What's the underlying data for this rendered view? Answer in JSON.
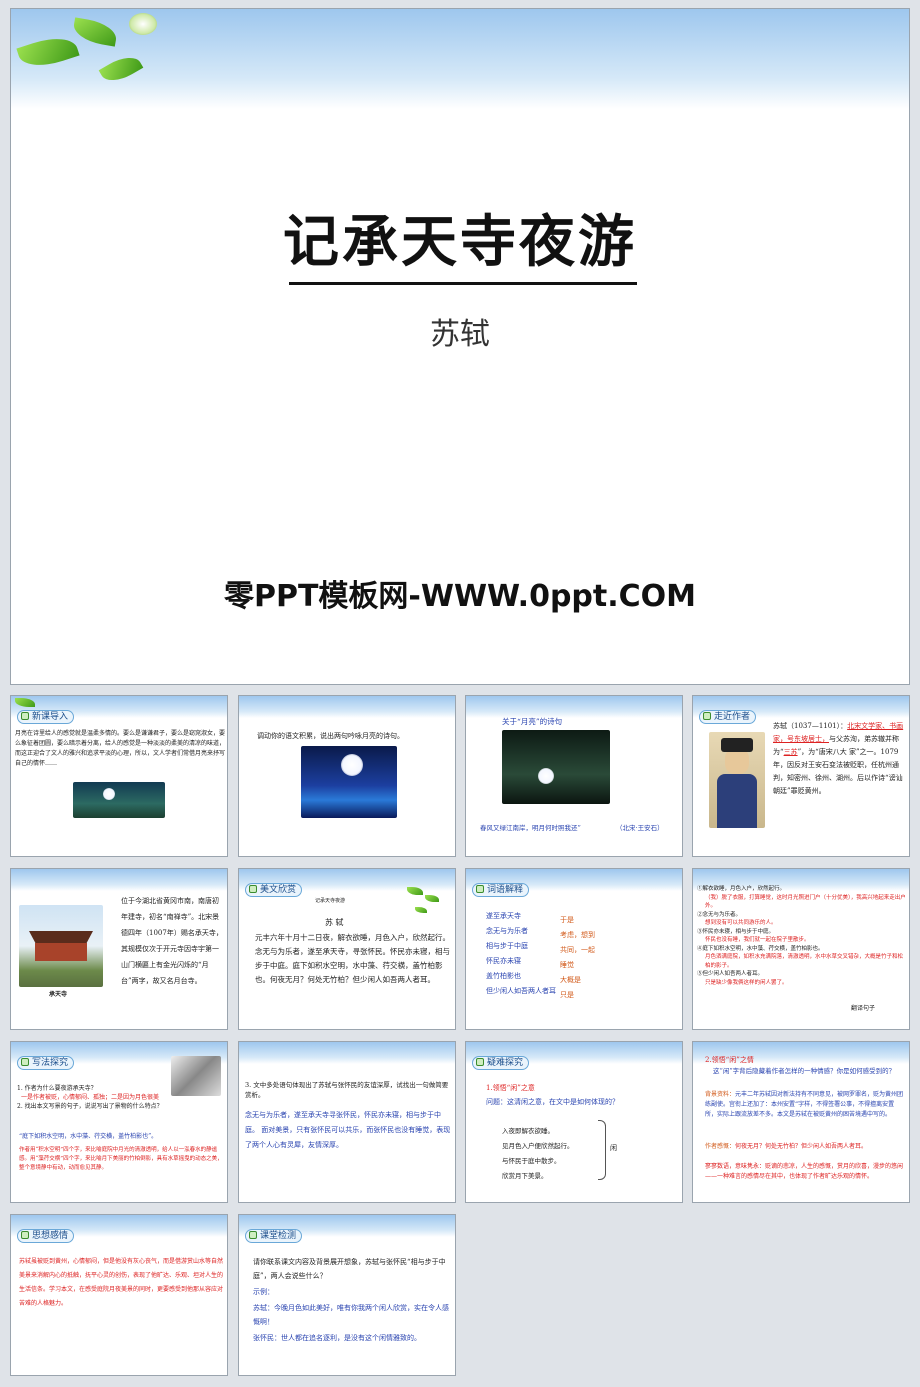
{
  "cover": {
    "title": "记承天寺夜游",
    "author": "苏轼",
    "site": "零PPT模板网-WWW.0ppt.COM"
  },
  "s1": {
    "tag": "新课导入",
    "text": "月亮在诗里给人的感觉就是温柔多情的。要么是谦谦君子，要么是窈窕淑女，要么象征着团圆，要么暗示着分离，给人的感觉是一种淡淡的柔美的清凉的味道，而这正迎合了文人的雅兴和追求平淡的心理，所以，文人学者们常借月亮来抒写自己的情怀……"
  },
  "s2": {
    "text": "调动你的语文积累，说出两句吟咏月亮的诗句。"
  },
  "s3": {
    "head": "关于“月亮”的诗句",
    "poem": "春风又绿江南岸，明月何时照我还”",
    "cite": "（北宋·王安石）"
  },
  "s4": {
    "tag": "走近作者",
    "t1": "苏轼（1037—1101）：",
    "t1r": "北宋文学家、书画家，号东坡居士，",
    "t2": "与父苏洵，弟苏辙并称为“",
    "t2r": "三苏",
    "t3": "”，为“唐宋八大 家”之一。1079年，因反对王安石变法被贬职，任杭州通判，知密州、徐州、湖州。后以作诗“谤讪朝廷”罪贬黄州。"
  },
  "s5": {
    "text": "位于今湖北省黄冈市南，南唐初年建寺，初名“南禅寺”。北宋景德四年（1007年）赐名承天寺，其规模仅次于开元寺因寺宇第一山门横匾上有金光闪烁的“月台”两字，故又名月台寺。",
    "caption": "承天寺"
  },
  "s6": {
    "tag": "美文欣赏",
    "small": "记承天寺夜游",
    "author": "苏 轼",
    "text": "元丰六年十月十二日夜，解衣欲睡，月色入户，欣然起行。念无与为乐者，遂至承天寺，寻张怀民。怀民亦未寝，相与步于中庭。庭下如积水空明，水中藻、荇交横，盖竹柏影也。何夜无月？何处无竹柏？但少闲人如吾两人者耳。"
  },
  "s7": {
    "tag": "词语解释",
    "words": [
      "遂至承天寺",
      "念无与为乐者",
      "相与步于中庭",
      "怀民亦未寝",
      "盖竹柏影也",
      "但少闲人如吾两人者耳"
    ],
    "meanings": [
      "于是",
      "考虑，想到",
      "共同，一起",
      "睡觉",
      "大概是",
      "只是"
    ]
  },
  "s8": {
    "l1": "①解衣欲睡，月色入户，欣然起行。",
    "l1a": "（我）脱了衣服，打算睡觉，这时月光照进门户（十分优美），我高兴地起来走出户外。",
    "l2": "②念无与为乐者。",
    "l2a": "想到没有可以共同游乐的人。",
    "l3": "③怀民亦未寝，相与步于中庭。",
    "l3a": "怀民也没有睡，我们就一起在院子里散步。",
    "l4": "④庭下如积水空明，水中藻、荇交横，盖竹柏影也。",
    "l4a": "月色洒满庭院，如积水充满院落，清澈透明，水中水草交叉错杂，大概是竹子和松柏的影子。",
    "l5": "⑤但少闲人如吾两人者耳。",
    "l5a": "只是缺少像我俩这样的闲人罢了。",
    "note": "翻译句子"
  },
  "s9": {
    "tag": "写法探究",
    "q1": "1. 作者为什么要夜游承天寺？",
    "a1": "一是作者被贬，心情郁闷、孤独；二是因为月色很美",
    "q2": "2. 找出本文写景的句子，说说写出了景物的什么特点？",
    "quote": "“庭下如积水空明，水中藻、荇交横，盖竹柏影也”。",
    "ans": "作者用“积水空明”四个字，来比喻庭院中月光的清澈透明，给人以一泓春水的静谧感。用“藻荇交横”四个字，来比喻月下美丽的竹柏倒影，具有水草摇曳的动态之美，整个意境静中有动，动而愈见其静。"
  },
  "s10": {
    "q": "3. 文中多处语句体现出了苏轼与张怀民的友谊深厚，试找出一句做简要赏析。",
    "a": "念无与为乐者，遂至承天寺寻张怀民，怀民亦未寝，相与步于中庭。 面对美景，只有张怀民可以共乐，而张怀民也没有睡觉，表现了两个人心有灵犀，友情深厚。"
  },
  "s11": {
    "tag": "疑难探究",
    "h": "1.领悟“闲”之意",
    "q": "问题：这清闲之意，在文中是如何体现的？",
    "items": [
      "入夜即解衣欲睡。",
      "见月色入户便欣然起行。",
      "与怀民于庭中散步。",
      "欣赏月下美景。"
    ],
    "brace": "闲"
  },
  "s12": {
    "h": "2.领悟“闲”之情",
    "q": "这“闲”字背后隐藏着作者怎样的一种情感？你是如何感受到的？",
    "bg_label": "背景资料：",
    "bg": "元丰二年苏轼因对新法持有不同意见，被网罗罪名，贬为黄州团练副使。宫衔上还加了：本州安置“字样，不得签署公事，不得擅离安置所，实际上跟流放差不多。本文是苏轼在被贬黄州的困苦境遇中写的。",
    "f_label": "作者感慨：",
    "f": "何夜无月？何处无竹柏？但少闲人如吾两人者耳。",
    "e": "寥寥数语，意味隽永：贬谪的悲凉，人生的感慨，赏月的欣喜，漫步的悠闲——一种难言的感情尽在其中，也体现了作者旷达乐观的情怀。"
  },
  "s13": {
    "tag": "思想感情",
    "text": "苏轼虽被贬到黄州，心情郁闷，但是他没有灰心丧气，而是借游赏山水等自然美景来消解内心的抵触，抚平心灵的创伤，表现了他旷达、乐观、坦对人生的生活信条。学习本文，在感受庭院月夜美景的同时，更要感受到他那从容应对苦难的人格魅力。"
  },
  "s14": {
    "tag": "课堂检测",
    "q": "请你联系课文内容及背景展开想象，苏轼与张怀民“相与步于中庭”，两人会说些什么？",
    "ex": "示例：",
    "a1": "苏轼：今晚月色如此美好，唯有你我两个闲人欣赏，实在令人感慨啊！",
    "a2": "张怀民：世人都在追名逐利，是没有这个闲情雅致的。"
  }
}
